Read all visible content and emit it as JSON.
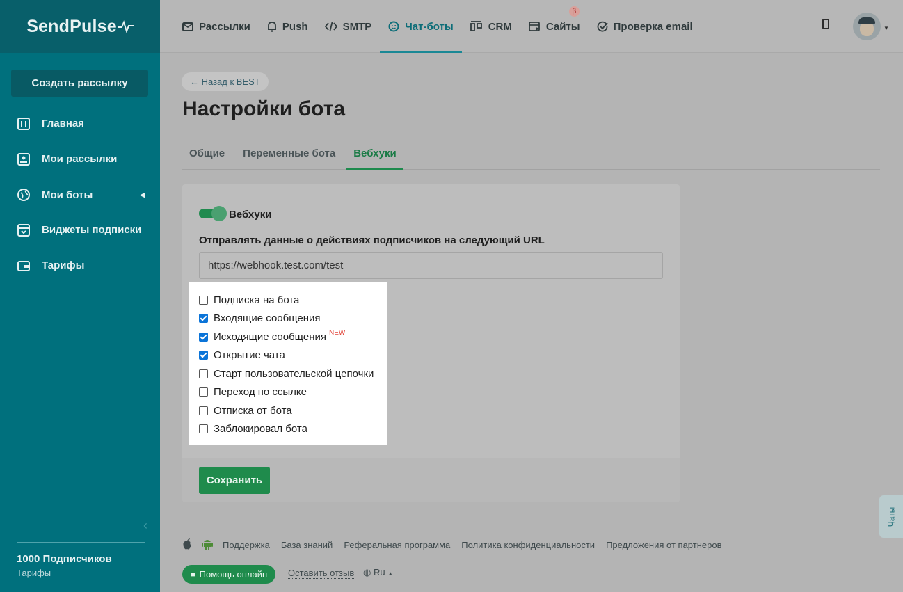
{
  "brand": {
    "name": "SendPulse"
  },
  "sidebar": {
    "create_button": "Создать рассылку",
    "items": [
      {
        "label": "Главная",
        "icon": "dashboard-icon"
      },
      {
        "label": "Мои рассылки",
        "icon": "mailings-icon"
      },
      {
        "label": "Мои боты",
        "icon": "globe-icon"
      },
      {
        "label": "Виджеты подписки",
        "icon": "widget-icon"
      },
      {
        "label": "Тарифы",
        "icon": "wallet-icon"
      }
    ],
    "subscribers": "1000 Подписчиков",
    "plan_link": "Тарифы"
  },
  "topnav": {
    "items": [
      {
        "label": "Рассылки",
        "icon": "envelope-icon"
      },
      {
        "label": "Push",
        "icon": "bell-icon"
      },
      {
        "label": "SMTP",
        "icon": "code-icon"
      },
      {
        "label": "Чат-боты",
        "icon": "chat-bot-icon"
      },
      {
        "label": "CRM",
        "icon": "crm-icon"
      },
      {
        "label": "Сайты",
        "icon": "website-icon",
        "badge": "β"
      },
      {
        "label": "Проверка email",
        "icon": "check-circle-icon"
      }
    ],
    "active": "Чат-боты"
  },
  "main": {
    "back_link": "← Назад к BEST",
    "title": "Настройки бота",
    "tabs": [
      "Общие",
      "Переменные бота",
      "Вебхуки"
    ],
    "active_tab": "Вебхуки",
    "webhooks": {
      "toggle_label": "Вебхуки",
      "toggle_on": true,
      "url_label": "Отправлять данные о действиях подписчиков на следующий URL",
      "url_value": "https://webhook.test.com/test",
      "events": [
        {
          "label": "Подписка на бота",
          "checked": false
        },
        {
          "label": "Входящие сообщения",
          "checked": true
        },
        {
          "label": "Исходящие сообщения",
          "checked": true,
          "badge": "NEW"
        },
        {
          "label": "Открытие чата",
          "checked": true
        },
        {
          "label": "Старт пользовательской цепочки",
          "checked": false
        },
        {
          "label": "Переход по ссылке",
          "checked": false
        },
        {
          "label": "Отписка от бота",
          "checked": false
        },
        {
          "label": "Заблокировал бота",
          "checked": false
        }
      ],
      "save_button": "Сохранить"
    }
  },
  "chats_tab": "Чаты",
  "footer": {
    "links": [
      "Поддержка",
      "База знаний",
      "Реферальная программа",
      "Политика конфиденциальности",
      "Предложения от партнеров"
    ],
    "help_button": "Помощь онлайн",
    "review_link": "Оставить отзыв",
    "language": "Ru"
  },
  "colors": {
    "sidebar": "#00707d",
    "accent_green": "#1f8b4c",
    "overlay": "#b4b4b4"
  }
}
